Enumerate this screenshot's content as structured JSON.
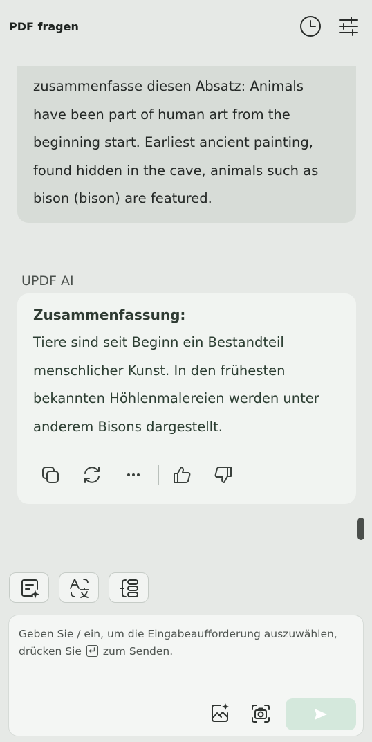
{
  "header": {
    "title": "PDF fragen",
    "history_icon": "clock-icon",
    "settings_icon": "sliders-icon"
  },
  "user_message": {
    "text": "zusammenfasse diesen Absatz: Animals have been part of human art from the beginning start. Earliest ancient painting, found hidden in the cave, animals such as bison (bison) are featured."
  },
  "ai_response": {
    "sender": "UPDF AI",
    "heading": "Zusammenfassung:",
    "body": "Tiere sind seit Beginn ein Bestandteil menschlicher Kunst. In den frühesten bekannten Höhlenmalereien werden unter anderem Bisons dargestellt.",
    "actions": [
      "copy-icon",
      "regenerate-icon",
      "more-icon",
      "thumbs-up-icon",
      "thumbs-down-icon"
    ]
  },
  "toolbar": {
    "buttons": [
      "summarize-icon",
      "translate-icon",
      "explain-icon"
    ]
  },
  "input": {
    "placeholder_part1": "Geben Sie / ein, um die Eingabeaufforderung auszuwählen, drücken Sie",
    "placeholder_part2": "zum Senden.",
    "icons": [
      "image-ai-icon",
      "screenshot-icon",
      "send-icon"
    ]
  },
  "colors": {
    "background": "#e6e9e6",
    "user_bubble": "#d7dcd7",
    "ai_card": "#f1f4f1",
    "ai_text": "#2b3d31",
    "send_button": "#d4e8dc"
  }
}
